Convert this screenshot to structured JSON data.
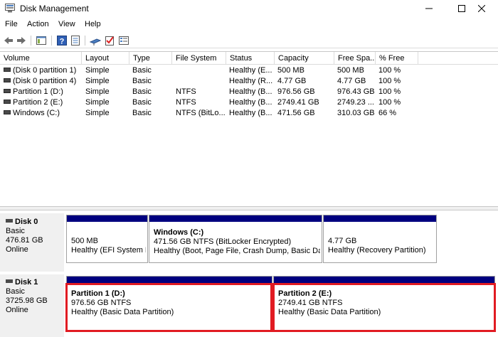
{
  "window": {
    "title": "Disk Management",
    "controls": {
      "minimize": "—",
      "maximize": "☐",
      "close": "✕"
    }
  },
  "menu": [
    "File",
    "Action",
    "View",
    "Help"
  ],
  "toolbar": {
    "icons": [
      "back-icon",
      "forward-icon",
      "console-tree-icon",
      "help-icon",
      "properties-icon",
      "connect-icon",
      "check-icon",
      "list-icon"
    ]
  },
  "volume_list": {
    "columns": [
      "Volume",
      "Layout",
      "Type",
      "File System",
      "Status",
      "Capacity",
      "Free Spa...",
      "% Free"
    ],
    "rows": [
      [
        "(Disk 0 partition 1)",
        "Simple",
        "Basic",
        "",
        "Healthy (E...",
        "500 MB",
        "500 MB",
        "100 %"
      ],
      [
        "(Disk 0 partition 4)",
        "Simple",
        "Basic",
        "",
        "Healthy (R...",
        "4.77 GB",
        "4.77 GB",
        "100 %"
      ],
      [
        "Partition 1 (D:)",
        "Simple",
        "Basic",
        "NTFS",
        "Healthy (B...",
        "976.56 GB",
        "976.43 GB",
        "100 %"
      ],
      [
        "Partition 2 (E:)",
        "Simple",
        "Basic",
        "NTFS",
        "Healthy (B...",
        "2749.41 GB",
        "2749.23 ...",
        "100 %"
      ],
      [
        "Windows (C:)",
        "Simple",
        "Basic",
        "NTFS (BitLo...",
        "Healthy (B...",
        "471.56 GB",
        "310.03 GB",
        "66 %"
      ]
    ]
  },
  "disks": [
    {
      "name": "Disk 0",
      "type": "Basic",
      "size": "476.81 GB",
      "state": "Online",
      "partitions": [
        {
          "name": "",
          "detail": "500 MB",
          "status": "Healthy (EFI System Pa"
        },
        {
          "name": "Windows  (C:)",
          "detail": "471.56 GB NTFS (BitLocker Encrypted)",
          "status": "Healthy (Boot, Page File, Crash Dump, Basic Data I"
        },
        {
          "name": "",
          "detail": "4.77 GB",
          "status": "Healthy (Recovery Partition)"
        }
      ]
    },
    {
      "name": "Disk 1",
      "type": "Basic",
      "size": "3725.98 GB",
      "state": "Online",
      "partitions": [
        {
          "name": "Partition 1  (D:)",
          "detail": "976.56 GB NTFS",
          "status": "Healthy (Basic Data Partition)"
        },
        {
          "name": "Partition 2  (E:)",
          "detail": "2749.41 GB NTFS",
          "status": "Healthy (Basic Data Partition)"
        }
      ]
    }
  ],
  "colors": {
    "partition_bar": "#00007f",
    "highlight": "#e11b22",
    "disk_panel": "#f0f0f0"
  }
}
